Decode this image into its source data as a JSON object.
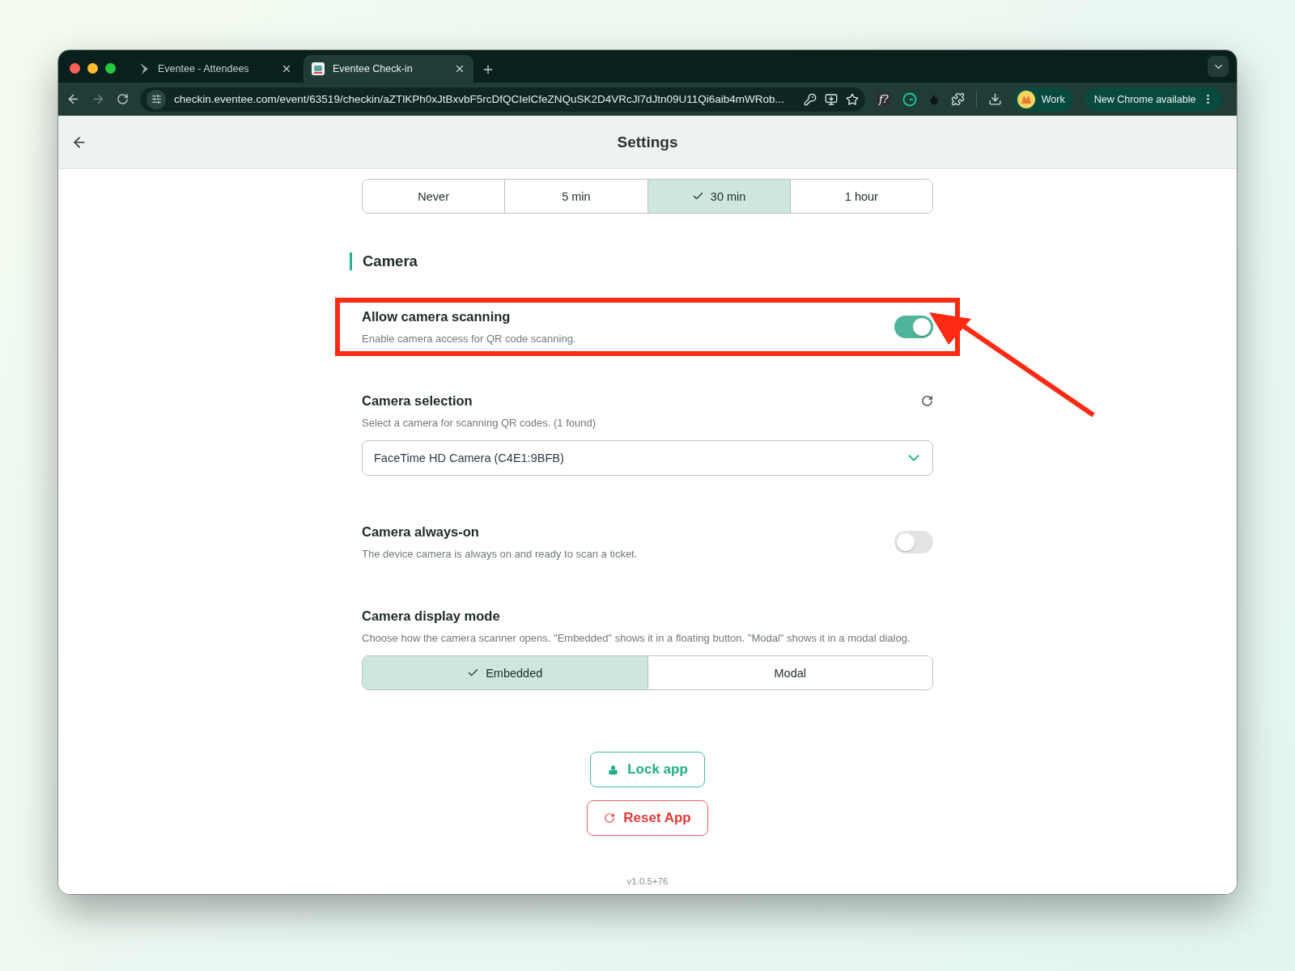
{
  "browser": {
    "tabs": [
      {
        "title": "Eventee - Attendees",
        "selected": false
      },
      {
        "title": "Eventee Check-in",
        "selected": true
      }
    ],
    "url": "checkin.eventee.com/event/63519/checkin/aZTlKPh0xJtBxvbF5rcDfQCIelCfeZNQuSK2D4VRcJl7dJtn09U11Qi6aib4mWRob...",
    "extension_label": "f?",
    "profile": "Work",
    "update_button": "New Chrome available"
  },
  "header": {
    "title": "Settings"
  },
  "timeout_options": [
    {
      "label": "Never",
      "selected": false
    },
    {
      "label": "5 min",
      "selected": false
    },
    {
      "label": "30 min",
      "selected": true
    },
    {
      "label": "1 hour",
      "selected": false
    }
  ],
  "section": {
    "title": "Camera"
  },
  "settings": [
    {
      "kind": "toggle",
      "title": "Allow camera scanning",
      "description": "Enable camera access for QR code scanning.",
      "on": true,
      "highlighted": true
    },
    {
      "kind": "select",
      "title": "Camera selection",
      "description": "Select a camera for scanning QR codes. (1 found)",
      "value": "FaceTime HD Camera (C4E1:9BFB)",
      "highlighted": false
    },
    {
      "kind": "toggle",
      "title": "Camera always-on",
      "description": "The device camera is always on and ready to scan a ticket.",
      "on": false,
      "highlighted": false
    },
    {
      "kind": "segmented",
      "title": "Camera display mode",
      "description": "Choose how the camera scanner opens. \"Embedded\" shows it in a floating button. \"Modal\" shows it in a modal dialog.",
      "options": [
        {
          "label": "Embedded",
          "selected": true
        },
        {
          "label": "Modal",
          "selected": false
        }
      ],
      "highlighted": false
    }
  ],
  "actions": [
    {
      "kind": "lock",
      "label": "Lock app"
    },
    {
      "kind": "reset",
      "label": "Reset App"
    }
  ],
  "version": "v1.0.5+76"
}
